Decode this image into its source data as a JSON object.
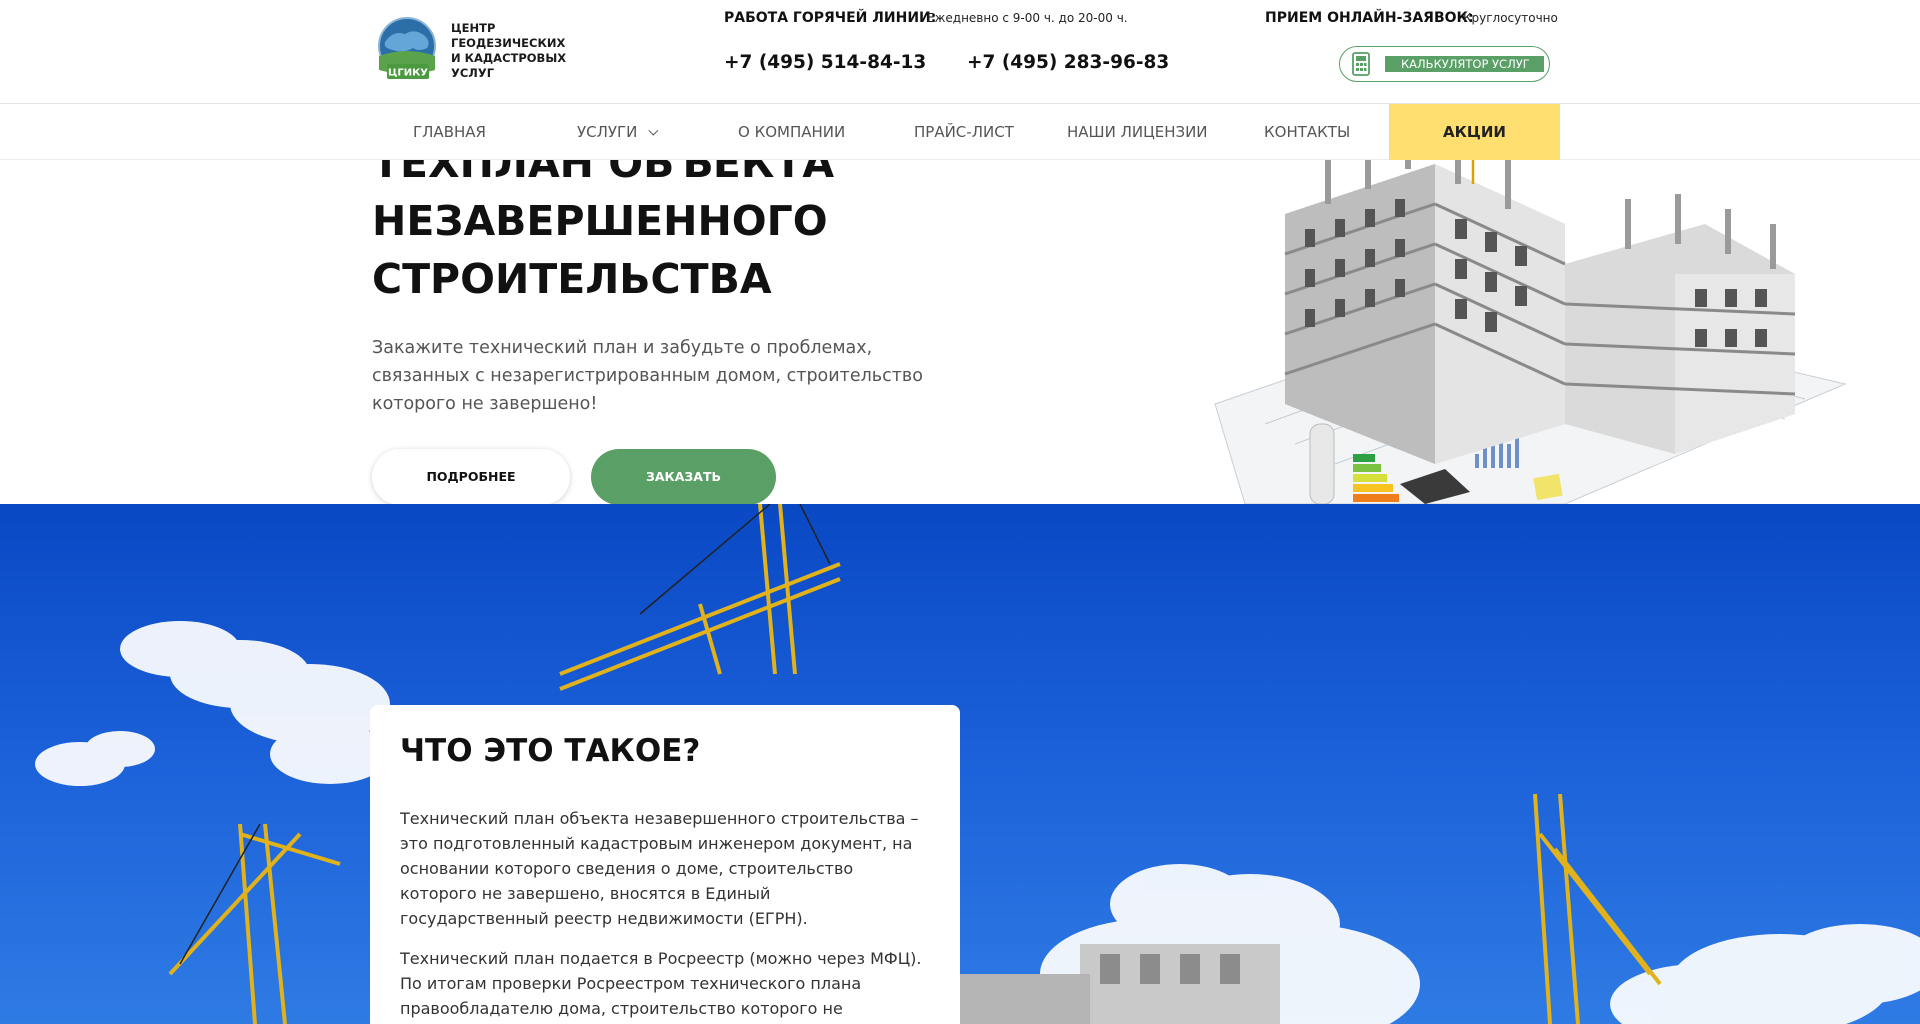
{
  "brand": {
    "logo_abbr": "ЦГИКУ",
    "name_line1": "ЦЕНТР ГЕОДЕЗИЧЕСКИХ",
    "name_line2": "И КАДАСТРОВЫХ УСЛУГ",
    "accent_color": "#5a9f66"
  },
  "contacts": {
    "hotline_label": "РАБОТА ГОРЯЧЕЙ ЛИНИИ:",
    "hotline_hours": "Ежедневно с 9-00 ч. до 20-00 ч.",
    "phone_1": "+7 (495) 514-84-13",
    "phone_2": "+7 (495) 283-96-83",
    "online_label": "ПРИЕМ ОНЛАЙН-ЗАЯВОК:",
    "online_hours": "Круглосуточно",
    "calculator_label": "КАЛЬКУЛЯТОР УСЛУГ"
  },
  "nav": {
    "items": [
      {
        "label": "ГЛАВНАЯ"
      },
      {
        "label": "УСЛУГИ"
      },
      {
        "label": "О КОМПАНИИ"
      },
      {
        "label": "ПРАЙС-ЛИСТ"
      },
      {
        "label": "НАШИ ЛИЦЕНЗИИ"
      },
      {
        "label": "КОНТАКТЫ"
      }
    ],
    "promo_label": "АКЦИИ",
    "promo_color": "#fedf6f"
  },
  "hero": {
    "title_line1": "ТЕХПЛАН ОБЪЕКТА",
    "title_line2": "НЕЗАВЕРШЕННОГО",
    "title_line3": "СТРОИТЕЛЬСТВА",
    "subtitle": "Закажите технический план и забудьте о проблемах, связанных с незарегистрированным домом, строительство которого не завершено!",
    "more_button": "ПОДРОБНЕЕ",
    "order_button": "ЗАКАЗАТЬ"
  },
  "info": {
    "title": "ЧТО ЭТО ТАКОЕ?",
    "paragraph_1": "Технический план объекта незавершенного строительства – это подготовленный кадастровым инженером документ, на основании которого сведения о доме, строительство которого не завершено, вносятся в Единый государственный реестр недвижимости (ЕГРН).",
    "paragraph_2": "Технический план подается в Росреестр (можно через МФЦ). По итогам проверки Росреестром технического плана правообладателю дома, строительство которого не завершено,"
  }
}
